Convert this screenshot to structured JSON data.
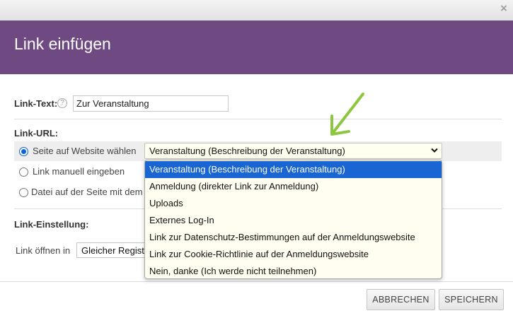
{
  "dialog": {
    "title": "Link einfügen",
    "close_symbol": "×",
    "header_color": "#6f4a82"
  },
  "link_text": {
    "label": "Link-Text:",
    "help_symbol": "?",
    "value": "Zur Veranstaltung"
  },
  "link_url": {
    "label": "Link-URL:",
    "options": [
      {
        "label": "Seite auf Website wählen",
        "checked": true
      },
      {
        "label": "Link manuell eingeben",
        "checked": false
      },
      {
        "label": "Datei auf der Seite mit dem",
        "checked": false
      }
    ],
    "page_select": {
      "selected": "Veranstaltung (Beschreibung der Veranstaltung)",
      "items": [
        "Veranstaltung (Beschreibung der Veranstaltung)",
        "Anmeldung (direkter Link zur Anmeldung)",
        "Uploads",
        "Externes Log-In",
        "Link zur Datenschutz-Bestimmungen auf der Anmeldungswebsite",
        "Link zur Cookie-Richtlinie auf der Anmeldungswebsite",
        "Nein, danke (Ich werde nicht teilnehmen)"
      ],
      "highlighted_index": 0
    }
  },
  "link_settings": {
    "label": "Link-Einstellung:",
    "open_in_label": "Link öffnen in",
    "open_in_value": "Gleicher Regist"
  },
  "footer": {
    "cancel_label": "ABBRECHEN",
    "save_label": "SPEICHERN"
  },
  "annotation": {
    "arrow_color": "#8dc63f",
    "arrow_icon": "green-arrow-icon"
  }
}
